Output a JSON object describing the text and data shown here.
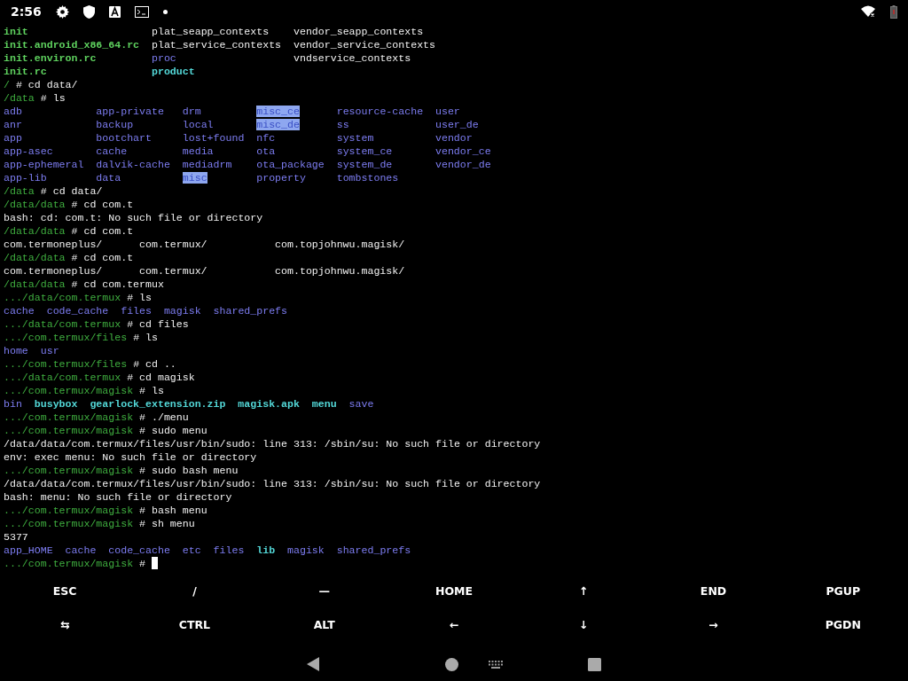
{
  "status_bar": {
    "time": "2:56"
  },
  "terminal": [
    {
      "kind": "listing",
      "rows": [
        [
          {
            "text": "init",
            "kind": "exec"
          },
          {
            "text": "plat_seapp_contexts",
            "kind": "file"
          },
          {
            "text": "vendor_seapp_contexts",
            "kind": "file"
          }
        ],
        [
          {
            "text": "init.android_x86_64.rc",
            "kind": "exec"
          },
          {
            "text": "plat_service_contexts",
            "kind": "file"
          },
          {
            "text": "vendor_service_contexts",
            "kind": "file"
          }
        ],
        [
          {
            "text": "init.environ.rc",
            "kind": "exec"
          },
          {
            "text": "proc",
            "kind": "dir"
          },
          {
            "text": "vndservice_contexts",
            "kind": "file"
          }
        ],
        [
          {
            "text": "init.rc",
            "kind": "exec"
          },
          {
            "text": "product",
            "kind": "link"
          }
        ]
      ]
    },
    {
      "kind": "prompt",
      "path": "/",
      "command": "cd data/"
    },
    {
      "kind": "prompt",
      "path": "/data",
      "command": "ls"
    },
    {
      "kind": "listing",
      "rows": [
        [
          {
            "text": "adb",
            "kind": "dir"
          },
          {
            "text": "app-private",
            "kind": "dir"
          },
          {
            "text": "drm",
            "kind": "dir"
          },
          {
            "text": "misc_ce",
            "kind": "sticky"
          },
          {
            "text": "resource-cache",
            "kind": "dir"
          },
          {
            "text": "user",
            "kind": "dir"
          }
        ],
        [
          {
            "text": "anr",
            "kind": "dir"
          },
          {
            "text": "backup",
            "kind": "dir"
          },
          {
            "text": "local",
            "kind": "dir"
          },
          {
            "text": "misc_de",
            "kind": "sticky"
          },
          {
            "text": "ss",
            "kind": "dir"
          },
          {
            "text": "user_de",
            "kind": "dir"
          }
        ],
        [
          {
            "text": "app",
            "kind": "dir"
          },
          {
            "text": "bootchart",
            "kind": "dir"
          },
          {
            "text": "lost+found",
            "kind": "dir"
          },
          {
            "text": "nfc",
            "kind": "dir"
          },
          {
            "text": "system",
            "kind": "dir"
          },
          {
            "text": "vendor",
            "kind": "dir"
          }
        ],
        [
          {
            "text": "app-asec",
            "kind": "dir"
          },
          {
            "text": "cache",
            "kind": "dir"
          },
          {
            "text": "media",
            "kind": "dir"
          },
          {
            "text": "ota",
            "kind": "dir"
          },
          {
            "text": "system_ce",
            "kind": "dir"
          },
          {
            "text": "vendor_ce",
            "kind": "dir"
          }
        ],
        [
          {
            "text": "app-ephemeral",
            "kind": "dir"
          },
          {
            "text": "dalvik-cache",
            "kind": "dir"
          },
          {
            "text": "mediadrm",
            "kind": "dir"
          },
          {
            "text": "ota_package",
            "kind": "dir"
          },
          {
            "text": "system_de",
            "kind": "dir"
          },
          {
            "text": "vendor_de",
            "kind": "dir"
          }
        ],
        [
          {
            "text": "app-lib",
            "kind": "dir"
          },
          {
            "text": "data",
            "kind": "dir"
          },
          {
            "text": "misc",
            "kind": "sticky"
          },
          {
            "text": "property",
            "kind": "dir"
          },
          {
            "text": "tombstones",
            "kind": "dir"
          }
        ]
      ]
    },
    {
      "kind": "prompt",
      "path": "/data",
      "command": "cd data/"
    },
    {
      "kind": "prompt",
      "path": "/data/data",
      "command": "cd com.t"
    },
    {
      "kind": "output",
      "text": "bash: cd: com.t: No such file or directory"
    },
    {
      "kind": "prompt",
      "path": "/data/data",
      "command": "cd com.t"
    },
    {
      "kind": "completion",
      "rows": [
        [
          {
            "text": "com.termoneplus/",
            "kind": "file"
          },
          {
            "text": "com.termux/",
            "kind": "file"
          },
          {
            "text": "com.topjohnwu.magisk/",
            "kind": "file"
          }
        ]
      ]
    },
    {
      "kind": "prompt",
      "path": "/data/data",
      "command": "cd com.t"
    },
    {
      "kind": "completion",
      "rows": [
        [
          {
            "text": "com.termoneplus/",
            "kind": "file"
          },
          {
            "text": "com.termux/",
            "kind": "file"
          },
          {
            "text": "com.topjohnwu.magisk/",
            "kind": "file"
          }
        ]
      ]
    },
    {
      "kind": "prompt",
      "path": "/data/data",
      "command": "cd com.termux"
    },
    {
      "kind": "prompt",
      "path": ".../data/com.termux",
      "command": "ls"
    },
    {
      "kind": "listing",
      "rows": [
        [
          {
            "text": "cache",
            "kind": "dir"
          },
          {
            "text": "code_cache",
            "kind": "dir"
          },
          {
            "text": "files",
            "kind": "dir"
          },
          {
            "text": "magisk",
            "kind": "dir"
          },
          {
            "text": "shared_prefs",
            "kind": "dir"
          }
        ]
      ]
    },
    {
      "kind": "prompt",
      "path": ".../data/com.termux",
      "command": "cd files"
    },
    {
      "kind": "prompt",
      "path": ".../com.termux/files",
      "command": "ls"
    },
    {
      "kind": "listing",
      "rows": [
        [
          {
            "text": "home",
            "kind": "dir"
          },
          {
            "text": "usr",
            "kind": "dir"
          }
        ]
      ]
    },
    {
      "kind": "prompt",
      "path": ".../com.termux/files",
      "command": "cd .."
    },
    {
      "kind": "prompt",
      "path": ".../data/com.termux",
      "command": "cd magisk"
    },
    {
      "kind": "prompt",
      "path": ".../com.termux/magisk",
      "command": "ls"
    },
    {
      "kind": "listing",
      "rows": [
        [
          {
            "text": "bin",
            "kind": "dir"
          },
          {
            "text": "busybox",
            "kind": "link"
          },
          {
            "text": "gearlock_extension.zip",
            "kind": "link"
          },
          {
            "text": "magisk.apk",
            "kind": "link"
          },
          {
            "text": "menu",
            "kind": "link"
          },
          {
            "text": "save",
            "kind": "dir"
          }
        ]
      ]
    },
    {
      "kind": "prompt",
      "path": ".../com.termux/magisk",
      "command": "./menu"
    },
    {
      "kind": "prompt",
      "path": ".../com.termux/magisk",
      "command": "sudo menu"
    },
    {
      "kind": "output",
      "text": "/data/data/com.termux/files/usr/bin/sudo: line 313: /sbin/su: No such file or directory"
    },
    {
      "kind": "output",
      "text": "env: exec menu: No such file or directory"
    },
    {
      "kind": "prompt",
      "path": ".../com.termux/magisk",
      "command": "sudo bash menu"
    },
    {
      "kind": "output",
      "text": "/data/data/com.termux/files/usr/bin/sudo: line 313: /sbin/su: No such file or directory"
    },
    {
      "kind": "output",
      "text": "bash: menu: No such file or directory"
    },
    {
      "kind": "prompt",
      "path": ".../com.termux/magisk",
      "command": "bash menu"
    },
    {
      "kind": "prompt",
      "path": ".../com.termux/magisk",
      "command": "sh menu"
    },
    {
      "kind": "output",
      "text": "5377"
    },
    {
      "kind": "listing",
      "rows": [
        [
          {
            "text": "app_HOME",
            "kind": "dir"
          },
          {
            "text": "cache",
            "kind": "dir"
          },
          {
            "text": "code_cache",
            "kind": "dir"
          },
          {
            "text": "etc",
            "kind": "dir"
          },
          {
            "text": "files",
            "kind": "dir"
          },
          {
            "text": "lib",
            "kind": "link"
          },
          {
            "text": "magisk",
            "kind": "dir"
          },
          {
            "text": "shared_prefs",
            "kind": "dir"
          }
        ]
      ]
    },
    {
      "kind": "prompt",
      "path": ".../com.termux/magisk",
      "cursor": true
    }
  ],
  "prompt_sign": "#",
  "extra_keys": [
    [
      "ESC",
      "/",
      "—",
      "HOME",
      "↑",
      "END",
      "PGUP"
    ],
    [
      "⇆",
      "CTRL",
      "ALT",
      "←",
      "↓",
      "→",
      "PGDN"
    ]
  ]
}
